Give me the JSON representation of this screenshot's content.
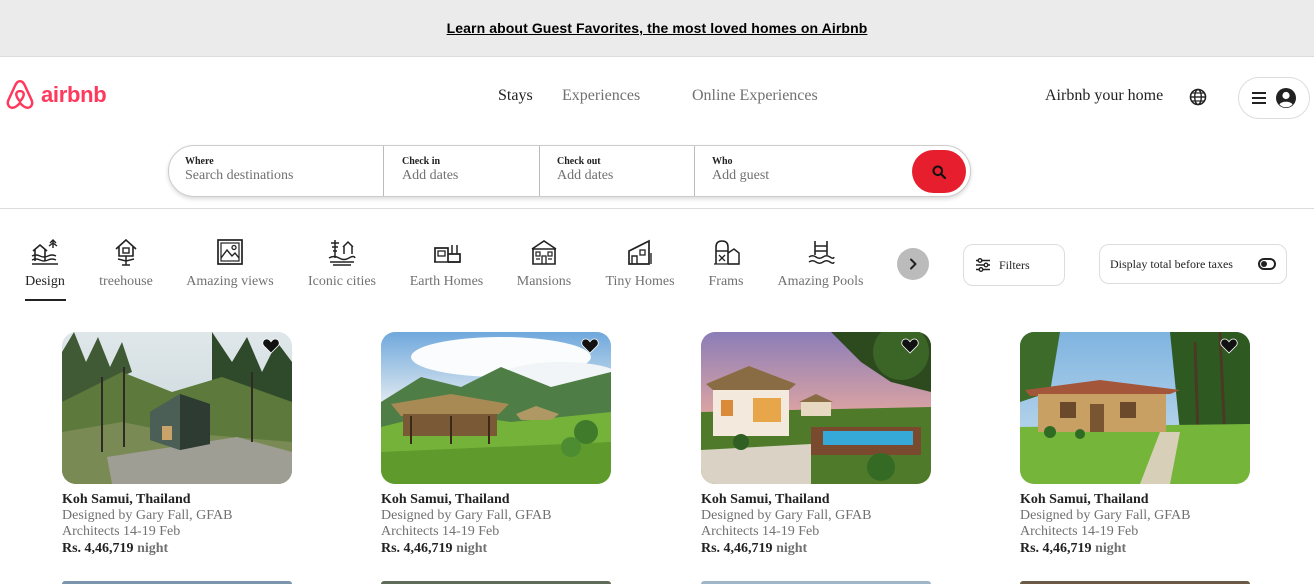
{
  "banner": {
    "text": "Learn about Guest Favorites, the most loved homes on Airbnb"
  },
  "logo": {
    "text": "airbnb"
  },
  "nav": {
    "tabs": [
      "Stays",
      "Experiences",
      "Online Experiences"
    ]
  },
  "header_right": {
    "host_link": "Airbnb your home",
    "globe_icon": "globe-icon",
    "menu_icon": "hamburger-icon",
    "avatar_icon": "user-avatar-icon"
  },
  "search": {
    "where_label": "Where",
    "where_placeholder": "Search destinations",
    "checkin_label": "Check in",
    "checkin_placeholder": "Add dates",
    "checkout_label": "Check out",
    "checkout_placeholder": "Add dates",
    "who_label": "Who",
    "who_placeholder": "Add guest",
    "button_color": "#e61e2d"
  },
  "categories": [
    {
      "label": "Design",
      "icon": "design-icon"
    },
    {
      "label": "treehouse",
      "icon": "treehouse-icon"
    },
    {
      "label": "Amazing views",
      "icon": "amazing-views-icon"
    },
    {
      "label": "Iconic cities",
      "icon": "iconic-cities-icon"
    },
    {
      "label": "Earth Homes",
      "icon": "earth-homes-icon"
    },
    {
      "label": "Mansions",
      "icon": "mansions-icon"
    },
    {
      "label": "Tiny Homes",
      "icon": "tiny-homes-icon"
    },
    {
      "label": "Frams",
      "icon": "farms-icon"
    },
    {
      "label": "Amazing Pools",
      "icon": "amazing-pools-icon"
    }
  ],
  "filters": {
    "label": "Filters"
  },
  "taxes_toggle": {
    "label": "Display total before taxes"
  },
  "listings": [
    {
      "title": "Koh Samui, Thailand",
      "designer": "Designed by Gary Fall, GFAB",
      "dates": "Architects 14-19 Feb",
      "price": "Rs. 4,46,719",
      "unit": "night"
    },
    {
      "title": "Koh Samui, Thailand",
      "designer": "Designed by Gary Fall, GFAB",
      "dates": "Architects 14-19 Feb",
      "price": "Rs. 4,46,719",
      "unit": "night"
    },
    {
      "title": "Koh Samui, Thailand",
      "designer": "Designed by Gary Fall, GFAB",
      "dates": "Architects 14-19 Feb",
      "price": "Rs. 4,46,719",
      "unit": "night"
    },
    {
      "title": "Koh Samui, Thailand",
      "designer": "Designed by Gary Fall, GFAB",
      "dates": "Architects 14-19 Feb",
      "price": "Rs. 4,46,719",
      "unit": "night"
    }
  ],
  "colors": {
    "brand": "#ff385c",
    "text": "#222222",
    "muted": "#717171"
  }
}
